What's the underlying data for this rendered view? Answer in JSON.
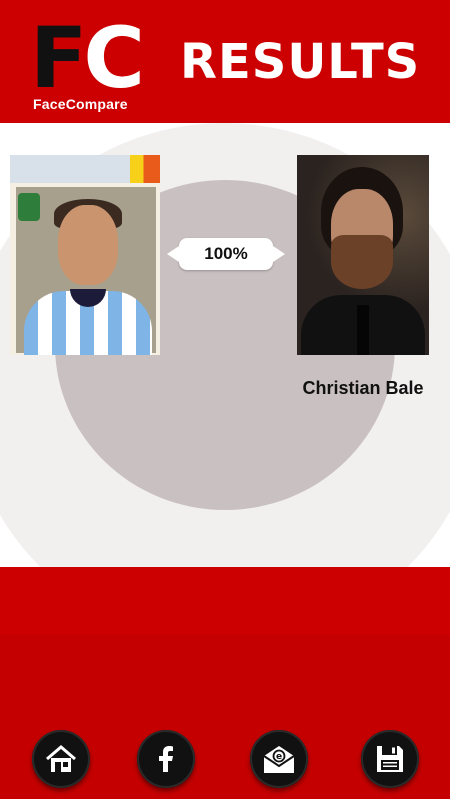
{
  "header": {
    "logo_letter_f": "F",
    "logo_letter_c": "C",
    "logo_subtitle": "FaceCompare",
    "title": "RESULTS"
  },
  "comparison": {
    "score": "100%",
    "match_name": "Christian Bale"
  },
  "nav": {
    "items": [
      {
        "icon": "home-icon"
      },
      {
        "icon": "facebook-icon"
      },
      {
        "icon": "email-icon"
      },
      {
        "icon": "save-icon"
      }
    ]
  },
  "colors": {
    "brand_red": "#cc0000",
    "button_black": "#111111"
  }
}
